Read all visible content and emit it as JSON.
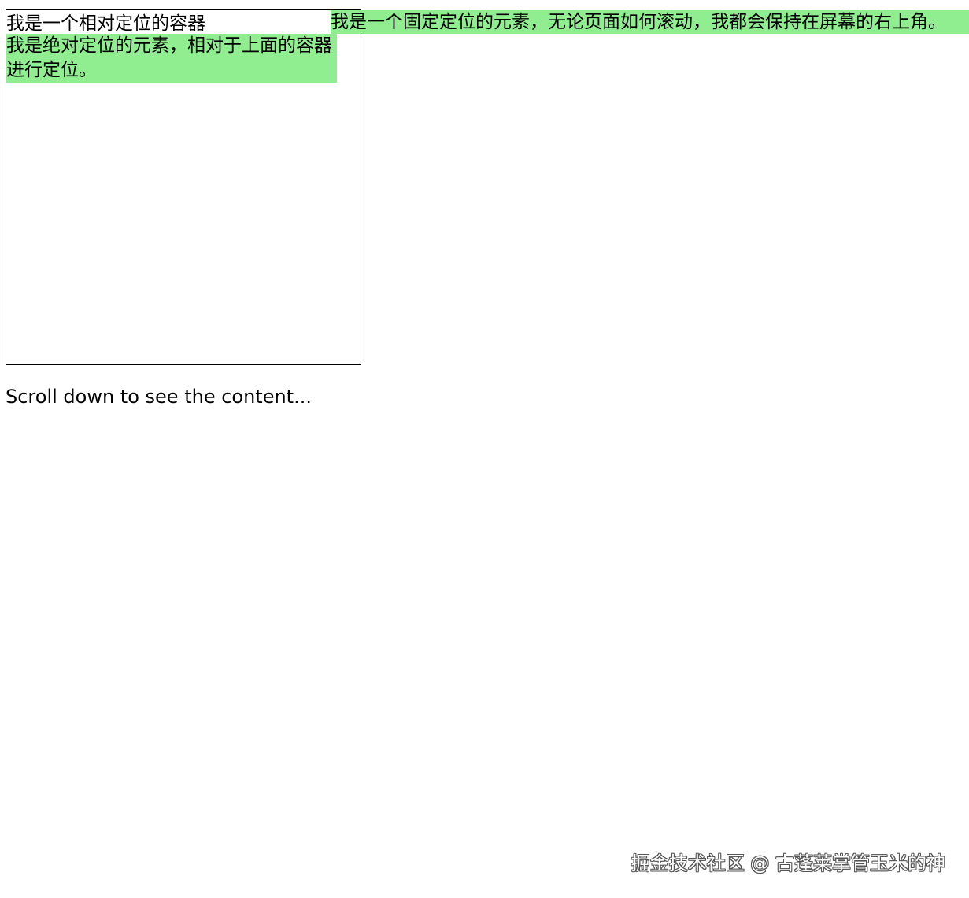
{
  "relative_container": {
    "label": "我是一个相对定位的容器",
    "absolute_child_text": "我是绝对定位的元素，相对于上面的容器进行定位。"
  },
  "fixed_element": {
    "text": "我是一个固定定位的元素，无论页面如何滚动，我都会保持在屏幕的右上角。"
  },
  "content": {
    "scroll_hint": "Scroll down to see the content..."
  },
  "watermark": {
    "text": "掘金技术社区 @ 古蓬莱掌管玉米的神"
  },
  "colors": {
    "highlight": "#90ee90",
    "border": "#000000",
    "background": "#ffffff"
  }
}
